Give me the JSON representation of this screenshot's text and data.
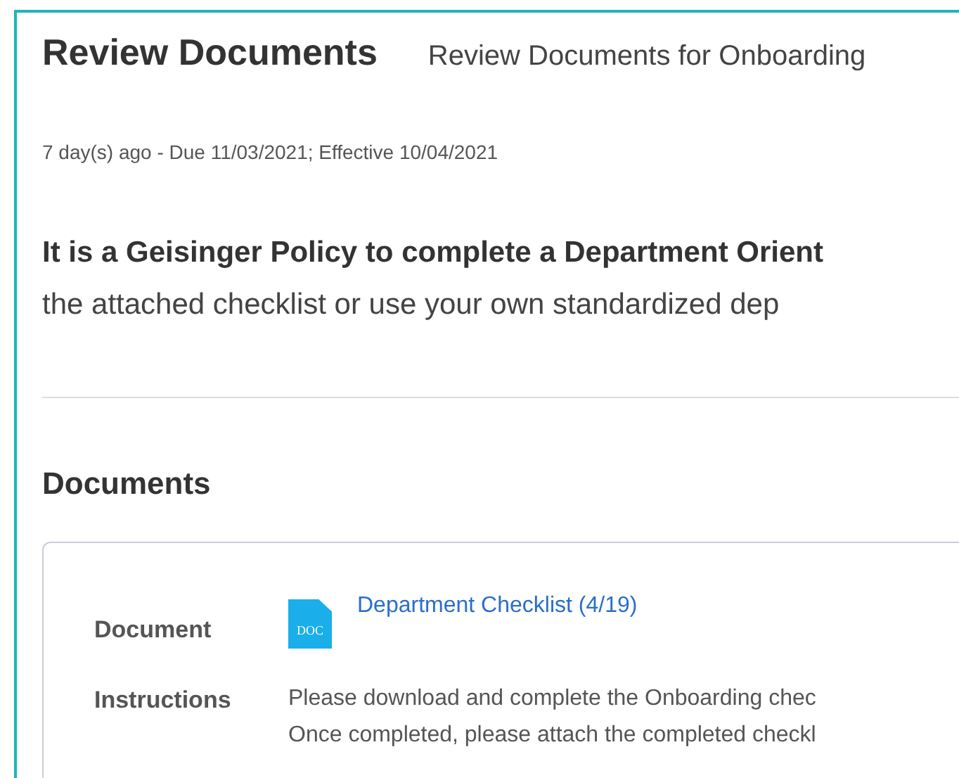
{
  "header": {
    "title": "Review Documents",
    "subtitle": "Review Documents for Onboarding"
  },
  "meta": "7 day(s) ago - Due 11/03/2021; Effective 10/04/2021",
  "policy": {
    "bold_line": "It is a Geisinger Policy to complete a Department Orient",
    "line": "the attached checklist or use your own standardized dep"
  },
  "documents": {
    "heading": "Documents",
    "document": {
      "label": "Document",
      "icon_text": "DOC",
      "link": "Department Checklist (4/19)"
    },
    "instructions": {
      "label": "Instructions",
      "lines": [
        "Please download and complete the Onboarding chec",
        "Once completed, please attach the completed checkl"
      ]
    }
  }
}
